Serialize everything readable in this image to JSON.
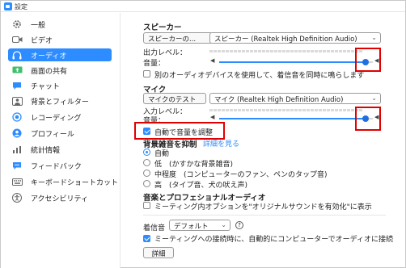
{
  "window": {
    "title": "設定"
  },
  "sidebar": {
    "items": [
      {
        "label": "一般",
        "icon": "gear-icon"
      },
      {
        "label": "ビデオ",
        "icon": "video-camera-icon"
      },
      {
        "label": "オーディオ",
        "icon": "headphones-icon",
        "active": true
      },
      {
        "label": "画面の共有",
        "icon": "share-screen-icon"
      },
      {
        "label": "チャット",
        "icon": "chat-icon"
      },
      {
        "label": "背景とフィルター",
        "icon": "background-icon"
      },
      {
        "label": "レコーディング",
        "icon": "record-icon"
      },
      {
        "label": "プロフィール",
        "icon": "profile-icon"
      },
      {
        "label": "統計情報",
        "icon": "statistics-icon"
      },
      {
        "label": "フィードバック",
        "icon": "feedback-icon"
      },
      {
        "label": "キーボードショートカット",
        "icon": "keyboard-icon"
      },
      {
        "label": "アクセシビリティ",
        "icon": "accessibility-icon"
      }
    ]
  },
  "speaker": {
    "heading": "スピーカー",
    "test_button": "スピーカーの...",
    "device": "スピーカー (Realtek High Definition Audio)",
    "output_level_label": "出力レベル：",
    "volume_label": "音量：",
    "volume_value": 0.95
  },
  "separate_device": {
    "label": "別のオーディオデバイスを使用して、着信音を同時に鳴らします",
    "checked": false
  },
  "mic": {
    "heading": "マイク",
    "test_button": "マイクのテスト",
    "device": "マイク (Realtek High Definition Audio)",
    "input_level_label": "入力レベル：",
    "volume_label": "音量：",
    "volume_value": 0.95
  },
  "auto_adjust": {
    "label": "自動で音量を調整",
    "checked": true
  },
  "noise": {
    "heading": "背景雑音を抑制",
    "learn_more": "詳細を見る",
    "options": [
      {
        "label": "自動",
        "checked": true
      },
      {
        "label": "低　(かすかな背景雑音)",
        "checked": false
      },
      {
        "label": "中程度　(コンピューターのファン、ペンのタップ音)",
        "checked": false
      },
      {
        "label": "高　(タイプ音、犬の吠え声)",
        "checked": false
      }
    ]
  },
  "music": {
    "heading": "音楽とプロフェショナルオーディオ",
    "original_sound_label": "ミーティング内オプションを\"オリジナルサウンドを有効化\"に表示",
    "original_sound_checked": false
  },
  "ringtone": {
    "label": "着信音",
    "value": "デフォルト"
  },
  "auto_join": {
    "label": "ミーティングへの接続時に、自動的にコンピューターでオーディオに接続",
    "checked": true
  },
  "advanced_button": "詳細",
  "colors": {
    "accent": "#2d8cff",
    "highlight": "#e00000"
  }
}
